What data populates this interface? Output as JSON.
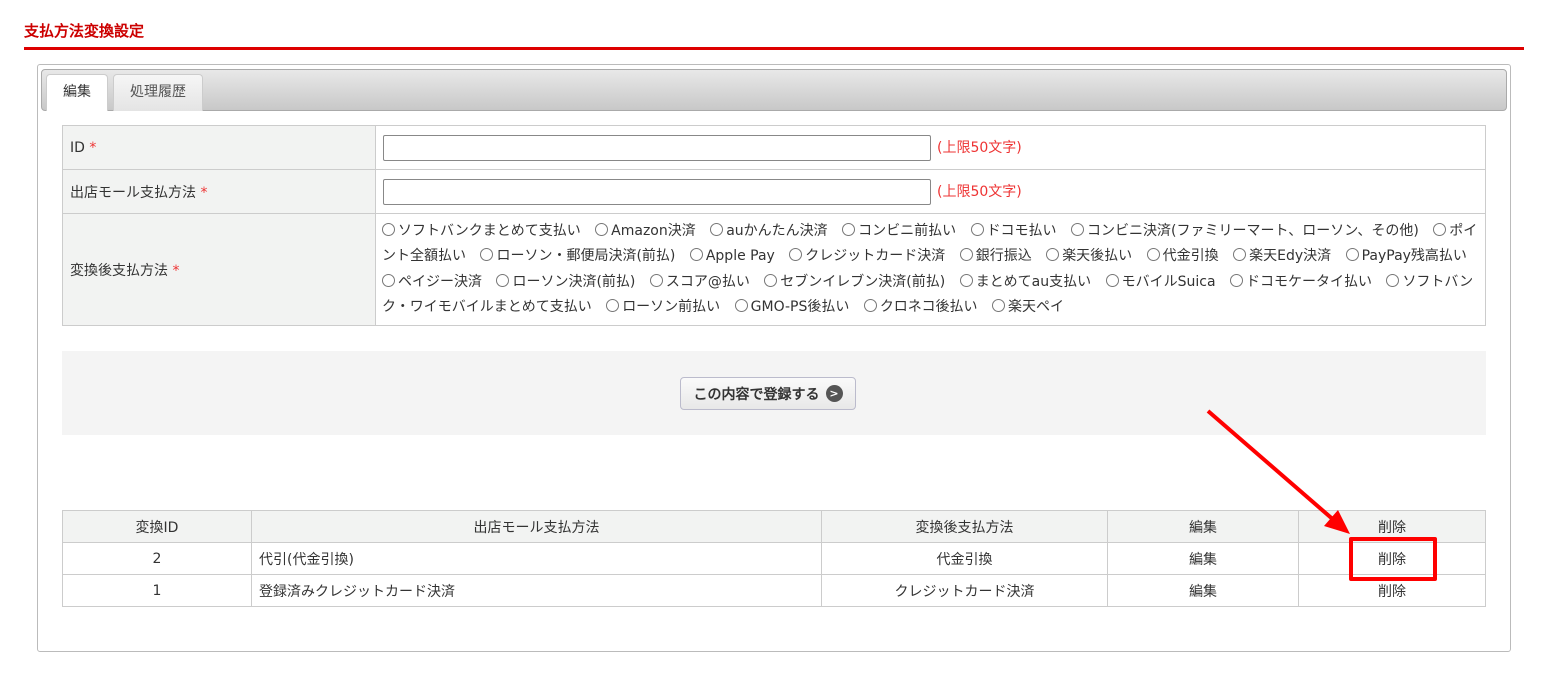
{
  "page_title": "支払方法変換設定",
  "tabs": [
    {
      "label": "編集",
      "active": true
    },
    {
      "label": "処理履歴",
      "active": false
    }
  ],
  "form": {
    "id_label": "ID",
    "required_mark": "*",
    "id_value": "",
    "limit_note": "(上限50文字)",
    "mall_label": "出店モール支払方法",
    "mall_value": "",
    "converted_label": "変換後支払方法",
    "options": [
      "ソフトバンクまとめて支払い",
      "Amazon決済",
      "auかんたん決済",
      "コンビニ前払い",
      "ドコモ払い",
      "コンビニ決済(ファミリーマート、ローソン、その他)",
      "ポイント全額払い",
      "ローソン・郵便局決済(前払)",
      "Apple Pay",
      "クレジットカード決済",
      "銀行振込",
      "楽天後払い",
      "代金引換",
      "楽天Edy決済",
      "PayPay残高払い",
      "ペイジー決済",
      "ローソン決済(前払)",
      "スコア@払い",
      "セブンイレブン決済(前払)",
      "まとめてau支払い",
      "モバイルSuica",
      "ドコモケータイ払い",
      "ソフトバンク・ワイモバイルまとめて支払い",
      "ローソン前払い",
      "GMO-PS後払い",
      "クロネコ後払い",
      "楽天ペイ"
    ]
  },
  "submit_label": "この内容で登録する",
  "list": {
    "headers": [
      "変換ID",
      "出店モール支払方法",
      "変換後支払方法",
      "編集",
      "削除"
    ],
    "rows": [
      {
        "id": "2",
        "mall": "代引(代金引換)",
        "converted": "代金引換",
        "edit": "編集",
        "delete": "削除"
      },
      {
        "id": "1",
        "mall": "登録済みクレジットカード決済",
        "converted": "クレジットカード決済",
        "edit": "編集",
        "delete": "削除"
      }
    ]
  },
  "colors": {
    "accent": "#cc0000",
    "annotation": "#ff0000"
  }
}
